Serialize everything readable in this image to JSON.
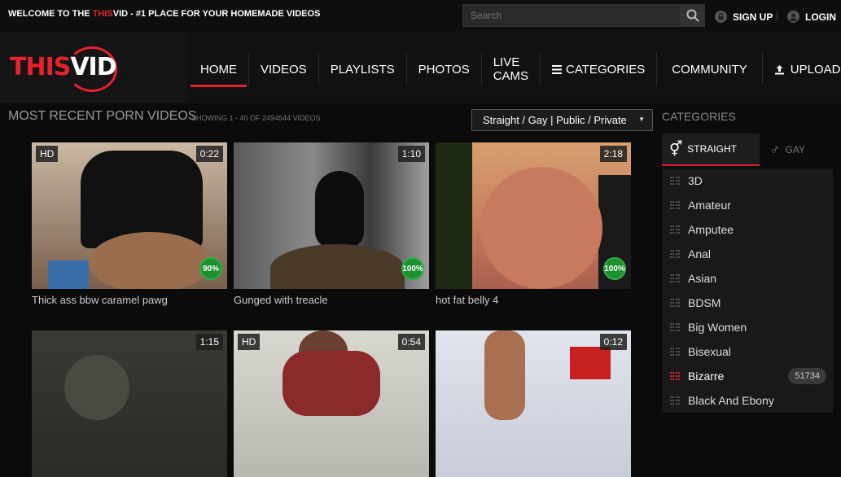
{
  "topbar": {
    "welcome_prefix": "WELCOME TO THE ",
    "welcome_brand_red": "THIS",
    "welcome_brand_rest": "VID - #1 PLACE FOR YOUR HOMEMADE VIDEOS",
    "search_placeholder": "Search",
    "signup": "SIGN UP",
    "login": "LOGIN",
    "separator": "|"
  },
  "logo": {
    "part1": "THIS",
    "part2": "VID"
  },
  "nav": [
    {
      "label": "HOME"
    },
    {
      "label": "VIDEOS"
    },
    {
      "label": "PLAYLISTS"
    },
    {
      "label": "PHOTOS"
    },
    {
      "label": "LIVE CAMS"
    },
    {
      "label": "CATEGORIES"
    },
    {
      "label": "COMMUNITY"
    },
    {
      "label": "UPLOAD"
    }
  ],
  "main": {
    "title": "MOST RECENT PORN VIDEOS",
    "showing": "SHOWING 1 - 40 OF 2494644 VIDEOS",
    "filter": "Straight / Gay | Public / Private"
  },
  "videos": [
    {
      "hd": "HD",
      "duration": "0:22",
      "rating": "90%",
      "title": "Thick ass bbw caramel pawg"
    },
    {
      "duration": "1:10",
      "rating": "100%",
      "title": "Gunged with treacle"
    },
    {
      "duration": "2:18",
      "rating": "100%",
      "title": "hot fat belly 4"
    },
    {
      "duration": "1:15"
    },
    {
      "hd": "HD",
      "duration": "0:54"
    },
    {
      "duration": "0:12"
    }
  ],
  "sidebar": {
    "title": "CATEGORIES",
    "tab_straight": "STRAIGHT",
    "tab_gay": "GAY",
    "categories": [
      {
        "label": "3D"
      },
      {
        "label": "Amateur"
      },
      {
        "label": "Amputee"
      },
      {
        "label": "Anal"
      },
      {
        "label": "Asian"
      },
      {
        "label": "BDSM"
      },
      {
        "label": "Big Women"
      },
      {
        "label": "Bisexual"
      },
      {
        "label": "Bizarre",
        "count": "51734"
      },
      {
        "label": "Black And Ebony"
      }
    ]
  },
  "colors": {
    "accent": "#e8222d",
    "rating_green": "#1d8f2f"
  }
}
